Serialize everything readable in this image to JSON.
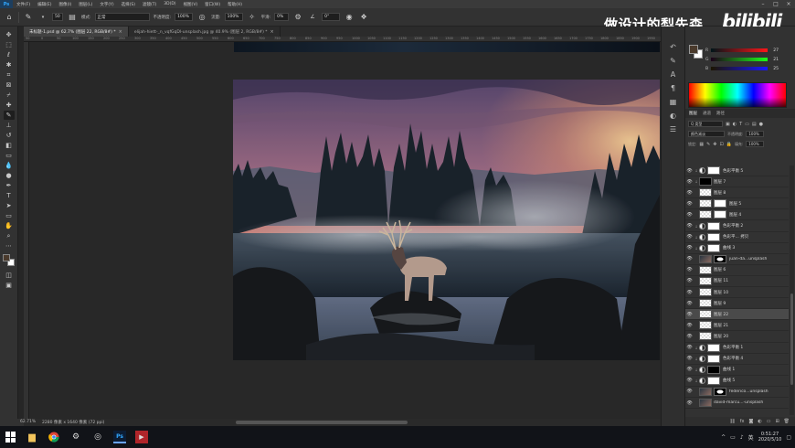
{
  "menubar": {
    "app_short": "Ps",
    "items": [
      "文件(F)",
      "编辑(E)",
      "图像(I)",
      "图层(L)",
      "文字(Y)",
      "选择(S)",
      "滤镜(T)",
      "3D(D)",
      "视图(V)",
      "窗口(W)",
      "帮助(H)"
    ]
  },
  "options": {
    "brush_size": "50",
    "mode_label": "模式:",
    "mode_value": "正常",
    "opacity_label": "不透明度:",
    "opacity_value": "100%",
    "flow_label": "流量:",
    "flow_value": "100%",
    "smooth_label": "平滑:",
    "smooth_value": "0%",
    "angle_value": "0°"
  },
  "watermark": {
    "text": "做设计的梨先森",
    "logo": "bilibili"
  },
  "tabs": [
    {
      "label": "未标题-1.psd @ 62.7% (图层 22, RGB/8#) *",
      "active": true
    },
    {
      "label": "elijah-hiett-_n_vqfGqDl-unsplash.jpg @ 40.9% (图层 2, RGB/8#) *",
      "active": false
    }
  ],
  "ruler": {
    "ticks": [
      "50",
      "0",
      "50",
      "100",
      "150",
      "200",
      "250",
      "300",
      "350",
      "400",
      "450",
      "500",
      "550",
      "600",
      "650",
      "700",
      "750",
      "800",
      "850",
      "900",
      "950",
      "1000",
      "1050",
      "1100",
      "1150",
      "1200",
      "1250",
      "1300",
      "1350",
      "1400",
      "1450",
      "1500",
      "1550",
      "1600",
      "1650",
      "1700",
      "1750",
      "1800",
      "1850",
      "1900",
      "1950"
    ]
  },
  "status": {
    "zoom": "62.71%",
    "doc": "2280 像素 x 1640 像素 (72 ppi)"
  },
  "color_panel": {
    "r_label": "R",
    "r_value": "27",
    "g_label": "G",
    "g_value": "21",
    "b_label": "B",
    "b_value": "25"
  },
  "layers_panel": {
    "tabs": [
      "图层",
      "通道",
      "路径"
    ],
    "filter_value": "Q 类型",
    "blend_value": "颜色减淡",
    "opacity_label": "不透明度:",
    "opacity_value": "100%",
    "lock_label": "锁定:",
    "fill_label": "填充:",
    "fill_value": "100%",
    "layers": [
      {
        "name": "色彩平衡 5",
        "thumb": "adj",
        "mask": "white",
        "clip": true,
        "selected": false
      },
      {
        "name": "图层 7",
        "thumb": "black",
        "mask": "none",
        "clip": true,
        "selected": false
      },
      {
        "name": "图层 8",
        "thumb": "checker",
        "mask": "none",
        "clip": false,
        "selected": false
      },
      {
        "name": "图层 5",
        "thumb": "checker",
        "mask": "white",
        "clip": false,
        "selected": false
      },
      {
        "name": "图层 4",
        "thumb": "checker",
        "mask": "white",
        "clip": false,
        "selected": false
      },
      {
        "name": "色彩平衡 2",
        "thumb": "adj",
        "mask": "white",
        "clip": true,
        "selected": false
      },
      {
        "name": "色彩平... 拷贝",
        "thumb": "adj",
        "mask": "white",
        "clip": true,
        "selected": false
      },
      {
        "name": "曲线 3",
        "thumb": "adj",
        "mask": "white",
        "clip": true,
        "selected": false
      },
      {
        "name": "juan-da...unsplash",
        "thumb": "photo",
        "mask": "shape",
        "clip": false,
        "selected": false
      },
      {
        "name": "图层 6",
        "thumb": "checker",
        "mask": "none",
        "clip": false,
        "selected": false
      },
      {
        "name": "图层 11",
        "thumb": "checker",
        "mask": "none",
        "clip": false,
        "selected": false
      },
      {
        "name": "图层 10",
        "thumb": "checker",
        "mask": "none",
        "clip": false,
        "selected": false
      },
      {
        "name": "图层 9",
        "thumb": "checker",
        "mask": "none",
        "clip": false,
        "selected": false
      },
      {
        "name": "图层 22",
        "thumb": "checker",
        "mask": "none",
        "clip": false,
        "selected": true
      },
      {
        "name": "图层 21",
        "thumb": "checker",
        "mask": "none",
        "clip": false,
        "selected": false
      },
      {
        "name": "图层 20",
        "thumb": "checker",
        "mask": "none",
        "clip": false,
        "selected": false
      },
      {
        "name": "色彩平衡 1",
        "thumb": "adj",
        "mask": "white",
        "clip": true,
        "selected": false
      },
      {
        "name": "色彩平衡 4",
        "thumb": "adj",
        "mask": "white",
        "clip": true,
        "selected": false
      },
      {
        "name": "曲线 1",
        "thumb": "adj",
        "mask": "black",
        "clip": true,
        "selected": false
      },
      {
        "name": "曲线 5",
        "thumb": "adj",
        "mask": "white",
        "clip": true,
        "selected": false
      },
      {
        "name": "federico...unsplash",
        "thumb": "photo",
        "mask": "shape",
        "clip": false,
        "selected": false
      },
      {
        "name": "david-marcu...-unsplash",
        "thumb": "photo",
        "mask": "none",
        "clip": false,
        "selected": false
      }
    ]
  },
  "taskbar": {
    "ime": "英",
    "time": "0:51:27",
    "date": "2020/5/10",
    "ps_label": "Ps"
  },
  "colors": {
    "accent": "#31a8ff",
    "panel": "#323232",
    "canvas": "#282828"
  }
}
